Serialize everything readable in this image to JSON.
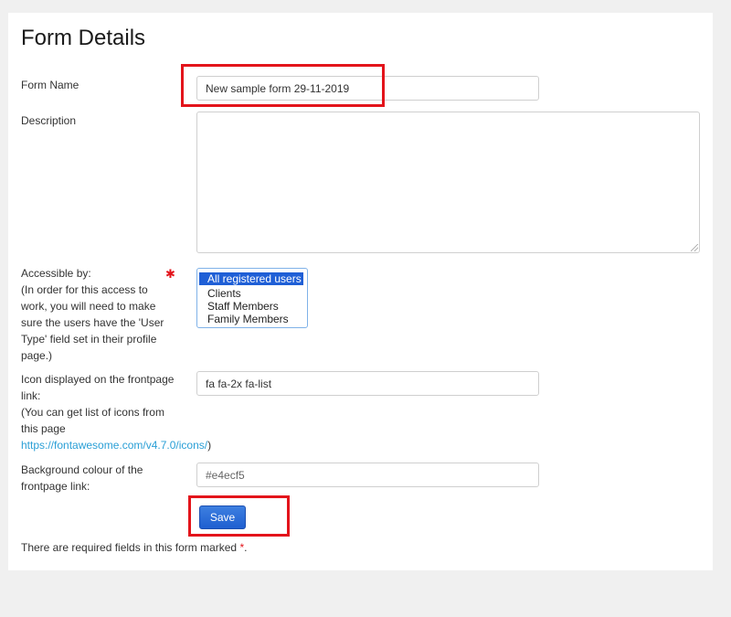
{
  "form": {
    "title": "Form Details",
    "name_label": "Form Name",
    "name_value": "New sample form 29-11-2019",
    "description_label": "Description",
    "description_value": "",
    "access": {
      "label": "Accessible by:",
      "help": "(In order for this access to work, you will need to make sure the users have the 'User Type' field set in their profile page.)",
      "required_marker": "✱",
      "options": [
        "All registered users",
        "Clients",
        "Staff Members",
        "Family Members"
      ],
      "selected": "All registered users"
    },
    "icon": {
      "label": "Icon displayed on the frontpage link:",
      "help": "(You can get list of icons from this page",
      "link_text": "https://fontawesome.com/v4.7.0/icons/",
      "link_suffix": ")",
      "value": "fa fa-2x fa-list"
    },
    "bgcolour": {
      "label": "Background colour of the frontpage link:",
      "placeholder": "#e4ecf5"
    },
    "save_label": "Save",
    "required_note": "There are required fields in this form marked",
    "required_note_marker": "*",
    "required_note_end": "."
  },
  "colors": {
    "primary": "#1f5fd6",
    "highlight": "#e3141b",
    "link": "#2a9fd6"
  }
}
